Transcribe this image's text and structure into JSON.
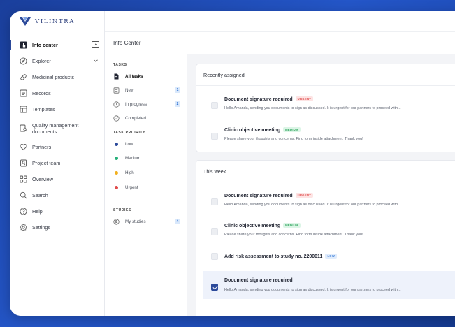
{
  "brand": {
    "name": "VILINTRA",
    "accent": "#2c4a9a"
  },
  "sidebar": {
    "items": [
      {
        "label": "Info center",
        "icon": "chart-icon"
      },
      {
        "label": "Explorer",
        "icon": "compass-icon"
      },
      {
        "label": "Medicinal products",
        "icon": "pill-icon"
      },
      {
        "label": "Records",
        "icon": "records-icon"
      },
      {
        "label": "Templates",
        "icon": "templates-icon"
      },
      {
        "label": "Quality management documents",
        "icon": "document-search-icon"
      },
      {
        "label": "Partners",
        "icon": "partners-icon"
      },
      {
        "label": "Project team",
        "icon": "team-icon"
      },
      {
        "label": "Overview",
        "icon": "grid-icon"
      },
      {
        "label": "Search",
        "icon": "search-icon"
      },
      {
        "label": "Help",
        "icon": "help-icon"
      },
      {
        "label": "Settings",
        "icon": "gear-icon"
      }
    ]
  },
  "page": {
    "title": "Info Center"
  },
  "filters": {
    "tasks_title": "TASKS",
    "tasks": [
      {
        "label": "All tasks"
      },
      {
        "label": "New",
        "count": "1"
      },
      {
        "label": "In progress",
        "count": "2"
      },
      {
        "label": "Completed"
      }
    ],
    "priority_title": "TASK PRIORITY",
    "priorities": [
      {
        "label": "Low",
        "color": "#2c4a9a"
      },
      {
        "label": "Medium",
        "color": "#27b07a"
      },
      {
        "label": "High",
        "color": "#f2b01e"
      },
      {
        "label": "Urgent",
        "color": "#e04b4b"
      }
    ],
    "studies_title": "STUDIES",
    "studies": [
      {
        "label": "My studies",
        "count": "4"
      }
    ]
  },
  "recent": {
    "title": "Recently assigned",
    "tasks": [
      {
        "title": "Document signature required",
        "badge": "URGENT",
        "desc": "Hello Amanda, sending you documents to sign as discussed. It is urgent for our partners to proceed with..."
      },
      {
        "title": "Clinic objective meeting",
        "badge": "MEDIUM",
        "desc": "Please share your thoughts and concerns. Find form inside attachment. Thank you!"
      }
    ]
  },
  "week": {
    "title": "This week",
    "tasks": [
      {
        "title": "Document signature required",
        "badge": "URGENT",
        "desc": "Hello Amanda, sending you documents to sign as discussed. It is urgent for our partners to proceed with..."
      },
      {
        "title": "Clinic objective meeting",
        "badge": "MEDIUM",
        "desc": "Please share your thoughts and concerns. Find form inside attachment. Thank you!"
      },
      {
        "title": "Add risk assessment to study no. 2200011",
        "badge": "LOW",
        "desc": ""
      },
      {
        "title": "Document signature required",
        "badge": "",
        "desc": "Hello Amanda, sending you documents to sign as discussed. It is urgent for our partners to proceed with...",
        "checked": true
      }
    ]
  }
}
